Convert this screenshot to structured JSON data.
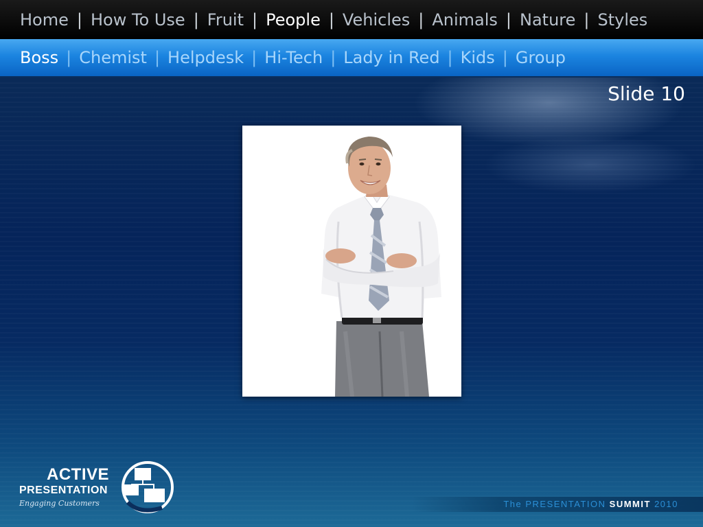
{
  "top_nav": {
    "items": [
      {
        "label": "Home",
        "active": false
      },
      {
        "label": "How To Use",
        "active": false
      },
      {
        "label": "Fruit",
        "active": false
      },
      {
        "label": "People",
        "active": true
      },
      {
        "label": "Vehicles",
        "active": false
      },
      {
        "label": "Animals",
        "active": false
      },
      {
        "label": "Nature",
        "active": false
      },
      {
        "label": "Styles",
        "active": false
      }
    ],
    "separator": "|"
  },
  "sub_nav": {
    "items": [
      {
        "label": "Boss",
        "active": true
      },
      {
        "label": "Chemist",
        "active": false
      },
      {
        "label": "Helpdesk",
        "active": false
      },
      {
        "label": "Hi-Tech",
        "active": false
      },
      {
        "label": "Lady in Red",
        "active": false
      },
      {
        "label": "Kids",
        "active": false
      },
      {
        "label": "Group",
        "active": false
      }
    ],
    "separator": "|"
  },
  "slide": {
    "number_label": "Slide 10",
    "image_icon": "businessman-photo"
  },
  "logo": {
    "line1": "ACTIVE",
    "line2": "PRESENTATION",
    "tagline": "Engaging Customers",
    "icon": "org-chart-globe-icon"
  },
  "footer": {
    "the": "The",
    "presentation": "PRESENTATION",
    "summit": "SUMMIT",
    "year": "2010"
  },
  "colors": {
    "top_nav_bg": "#000000",
    "sub_nav_bg": "#1b84e0",
    "active_text": "#ffffff",
    "inactive_top": "#b9c2cc",
    "inactive_sub": "#a8d6fb",
    "background": "#0b2e5c"
  }
}
